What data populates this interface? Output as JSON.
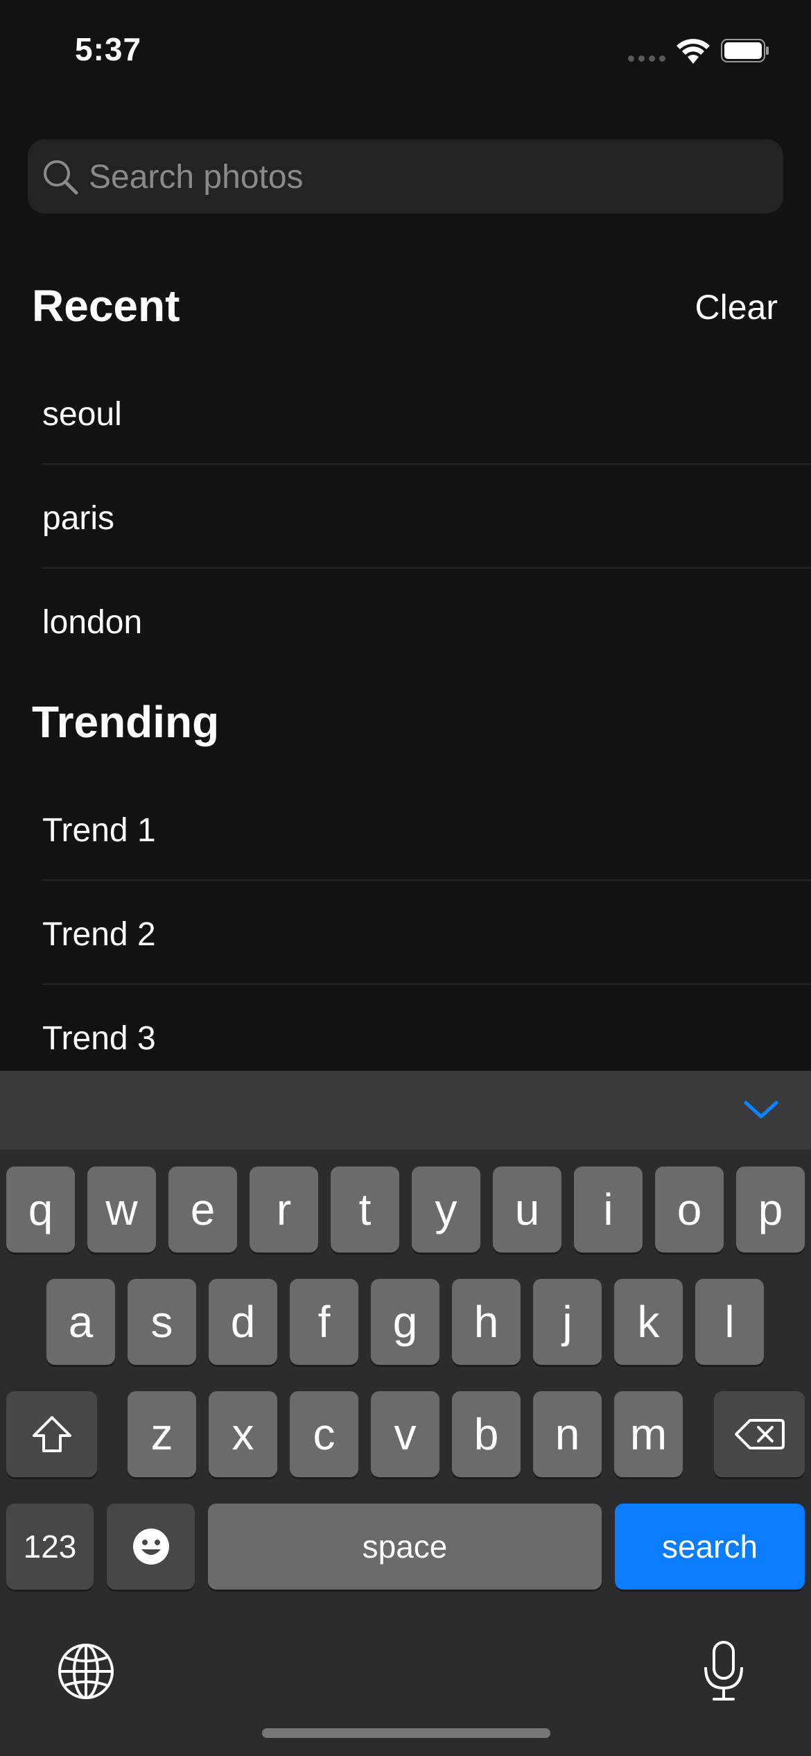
{
  "status_bar": {
    "time": "5:37"
  },
  "search": {
    "placeholder": "Search photos",
    "value": ""
  },
  "recent": {
    "title": "Recent",
    "clear_label": "Clear",
    "items": [
      "seoul",
      "paris",
      "london"
    ]
  },
  "trending": {
    "title": "Trending",
    "items": [
      "Trend 1",
      "Trend 2",
      "Trend 3"
    ]
  },
  "keyboard": {
    "row1": [
      "q",
      "w",
      "e",
      "r",
      "t",
      "y",
      "u",
      "i",
      "o",
      "p"
    ],
    "row2": [
      "a",
      "s",
      "d",
      "f",
      "g",
      "h",
      "j",
      "k",
      "l"
    ],
    "row3": [
      "z",
      "x",
      "c",
      "v",
      "b",
      "n",
      "m"
    ],
    "numbers_label": "123",
    "space_label": "space",
    "return_label": "search",
    "return_color": "#0a7cff"
  }
}
